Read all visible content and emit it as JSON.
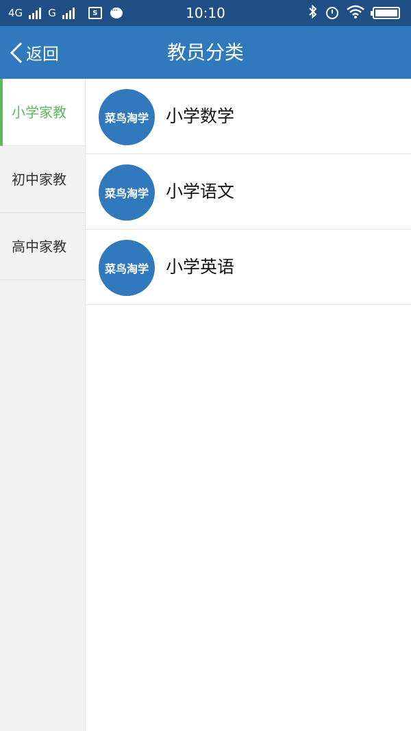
{
  "status_bar": {
    "network1": "4G",
    "network2": "G",
    "sim_icon_text": "S",
    "time": "10:10",
    "icons": [
      "image-icon",
      "chat-icon",
      "bluetooth-icon",
      "alarm-icon",
      "wifi-icon",
      "battery-icon"
    ]
  },
  "header": {
    "back_label": "返回",
    "title": "教员分类"
  },
  "sidebar": {
    "items": [
      {
        "label": "小学家教",
        "active": true
      },
      {
        "label": "初中家教",
        "active": false
      },
      {
        "label": "高中家教",
        "active": false
      }
    ]
  },
  "list": {
    "items": [
      {
        "avatar_text": "菜鸟淘学",
        "label": "小学数学"
      },
      {
        "avatar_text": "菜鸟淘学",
        "label": "小学语文"
      },
      {
        "avatar_text": "菜鸟淘学",
        "label": "小学英语"
      }
    ]
  },
  "colors": {
    "status_bar": "#1f4f85",
    "header": "#3179bd",
    "accent_green": "#5fb85f",
    "avatar": "#3179bd"
  }
}
